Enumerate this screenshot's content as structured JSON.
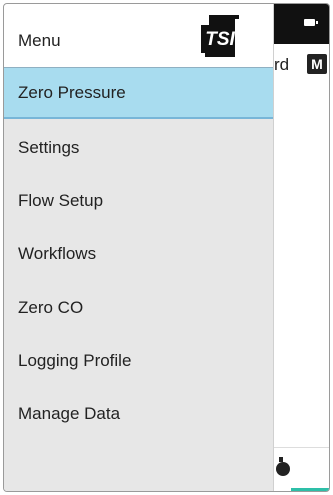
{
  "background_app": {
    "header_partial_text": "rd",
    "mode_badge": "M",
    "accent_color": "#2dbfa8"
  },
  "drawer": {
    "title": "Menu",
    "logo_text": "TSI",
    "items": [
      {
        "label": "Zero Pressure",
        "active": true
      },
      {
        "label": "Settings",
        "active": false
      },
      {
        "label": "Flow Setup",
        "active": false
      },
      {
        "label": "Workflows",
        "active": false
      },
      {
        "label": "Zero CO",
        "active": false
      },
      {
        "label": "Logging Profile",
        "active": false
      },
      {
        "label": "Manage Data",
        "active": false
      }
    ],
    "active_color": "#a8dcef"
  }
}
